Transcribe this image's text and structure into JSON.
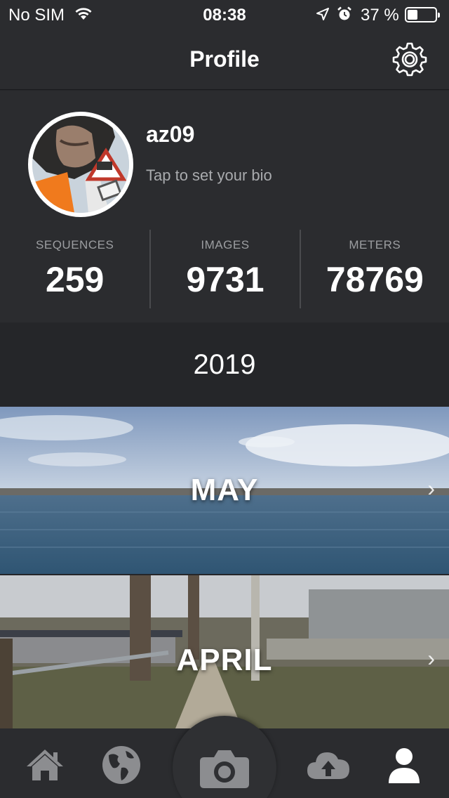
{
  "status_bar": {
    "carrier": "No SIM",
    "time": "08:38",
    "battery_percent": "37 %",
    "battery_level": 0.37
  },
  "nav": {
    "title": "Profile"
  },
  "profile": {
    "username": "az09",
    "bio_placeholder": "Tap to set your bio"
  },
  "stats": [
    {
      "label": "SEQUENCES",
      "value": "259"
    },
    {
      "label": "IMAGES",
      "value": "9731"
    },
    {
      "label": "METERS",
      "value": "78769"
    }
  ],
  "timeline": {
    "year": "2019",
    "months": [
      {
        "label": "MAY"
      },
      {
        "label": "APRIL"
      }
    ]
  },
  "tab_bar": {
    "items": [
      {
        "name": "home",
        "icon": "home-icon"
      },
      {
        "name": "explore",
        "icon": "globe-icon"
      },
      {
        "name": "capture",
        "icon": "camera-icon"
      },
      {
        "name": "upload",
        "icon": "cloud-upload-icon"
      },
      {
        "name": "profile",
        "icon": "user-icon",
        "active": true
      }
    ],
    "inactive_color": "#8c8d90",
    "active_color": "#ffffff"
  }
}
